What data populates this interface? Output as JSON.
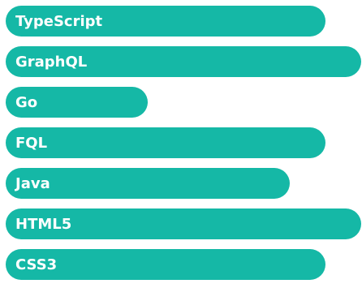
{
  "accent_color": "#15b8a6",
  "skills": [
    {
      "label": "TypeScript",
      "level": 0.9
    },
    {
      "label": "GraphQL",
      "level": 1.0
    },
    {
      "label": "Go",
      "level": 0.4
    },
    {
      "label": "FQL",
      "level": 0.9
    },
    {
      "label": "Java",
      "level": 0.8
    },
    {
      "label": "HTML5",
      "level": 1.0
    },
    {
      "label": "CSS3",
      "level": 0.9
    }
  ]
}
